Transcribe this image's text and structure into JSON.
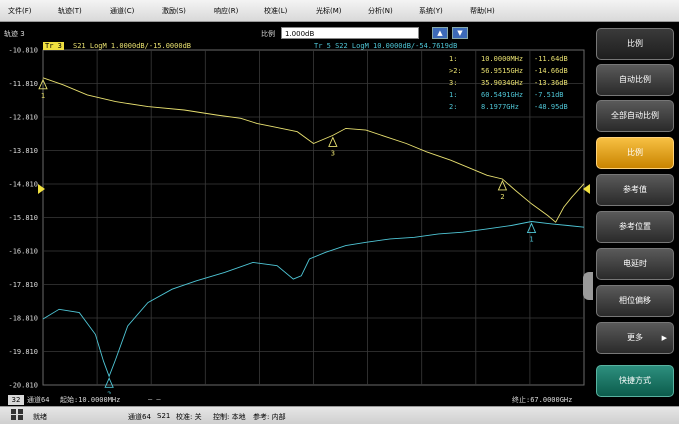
{
  "menu": [
    "文件(F)",
    "轨迹(T)",
    "通道(C)",
    "激励(S)",
    "响应(R)",
    "校准(L)",
    "光标(M)",
    "分析(N)",
    "系统(Y)",
    "帮助(H)"
  ],
  "trace_title": "轨迹 3",
  "scale": {
    "label": "比例",
    "value": "1.000dB"
  },
  "trace_headers": {
    "tr3_tag": "Tr 3",
    "tr3_text": "S21 LogM 1.0000dB/-15.0000dB",
    "tr5_text": "Tr 5  S22 LogM 10.0000dB/-54.7619dB"
  },
  "markers": [
    {
      "prefix": "1:",
      "freq": "10.0000MHz",
      "value": "-11.64dB",
      "color": "#e8e070"
    },
    {
      "prefix": ">2:",
      "freq": "56.9515GHz",
      "value": "-14.66dB",
      "color": "#e8e070"
    },
    {
      "prefix": "3:",
      "freq": "35.9034GHz",
      "value": "-13.36dB",
      "color": "#e8e070"
    },
    {
      "prefix": "1:",
      "freq": "60.5491GHz",
      "value": "-7.51dB",
      "color": "#4fc6d6"
    },
    {
      "prefix": "2:",
      "freq": "8.1977GHz",
      "value": "-48.95dB",
      "color": "#4fc6d6"
    }
  ],
  "side_buttons": [
    {
      "label": "比例",
      "style": "title"
    },
    {
      "label": "自动比例",
      "style": "normal"
    },
    {
      "label": "全部自动比例",
      "style": "normal"
    },
    {
      "label": "比例",
      "style": "active"
    },
    {
      "label": "参考值",
      "style": "normal"
    },
    {
      "label": "参考位置",
      "style": "normal"
    },
    {
      "label": "电延时",
      "style": "normal"
    },
    {
      "label": "相位偏移",
      "style": "normal"
    },
    {
      "label": "更多",
      "style": "normal",
      "arrow": "▶"
    },
    {
      "label": "快捷方式",
      "style": "teal"
    }
  ],
  "channel": {
    "num": "32",
    "name": "通道64",
    "start": "起始:10.0000MHz",
    "dash": "— —",
    "stop": "终止:67.0000GHz"
  },
  "status": {
    "ready": "就绪",
    "channel": "通道64",
    "param": "S21",
    "cal": "校准: 关",
    "ctrl": "控制: 本地",
    "ref": "参考: 内部"
  },
  "colors": {
    "trace_s21": "#e8e070",
    "trace_s22": "#4fc6d6",
    "grid": "#3a3a3a",
    "active": "#f0b030"
  },
  "chart_data": {
    "type": "line",
    "y_ticks": [
      "-10.810",
      "-11.810",
      "-12.810",
      "-13.810",
      "-14.810",
      "-15.810",
      "-16.810",
      "-17.810",
      "-18.810",
      "-19.810",
      "-20.810"
    ],
    "ylim": [
      -20.81,
      -10.81
    ],
    "xlim": [
      0.01,
      67.0
    ],
    "x_unit": "GHz",
    "series": [
      {
        "name": "S21",
        "x": [
          0.01,
          2.5,
          5.5,
          9.0,
          13.0,
          17.5,
          21.5,
          24.5,
          26.5,
          28.5,
          31.5,
          33.5,
          35.9,
          37.5,
          40.0,
          42.5,
          45.0,
          47.5,
          50.5,
          53.0,
          55.0,
          56.9,
          58.5,
          60.5,
          62.5,
          63.5,
          64.5,
          65.5,
          67.0
        ],
        "y": [
          -11.64,
          -11.85,
          -12.15,
          -12.35,
          -12.5,
          -12.6,
          -12.75,
          -12.85,
          -13.0,
          -13.1,
          -13.25,
          -13.6,
          -13.36,
          -13.15,
          -13.2,
          -13.4,
          -13.6,
          -13.85,
          -14.1,
          -14.35,
          -14.55,
          -14.66,
          -15.0,
          -15.4,
          -15.75,
          -15.95,
          -15.5,
          -15.2,
          -14.8
        ]
      },
      {
        "name": "S22",
        "x": [
          0.01,
          2.0,
          4.5,
          6.5,
          7.5,
          8.2,
          9.0,
          10.5,
          13.0,
          16.0,
          19.0,
          22.5,
          26.0,
          29.0,
          31.0,
          32.0,
          33.0,
          35.0,
          37.5,
          40.0,
          43.0,
          46.0,
          49.0,
          52.0,
          55.0,
          58.0,
          60.5,
          63.0,
          65.0,
          67.0
        ],
        "y": [
          -18.84,
          -18.55,
          -18.65,
          -19.3,
          -20.1,
          -20.55,
          -20.05,
          -19.05,
          -18.35,
          -17.95,
          -17.7,
          -17.45,
          -17.15,
          -17.25,
          -17.65,
          -17.55,
          -17.05,
          -16.85,
          -16.65,
          -16.55,
          -16.45,
          -16.4,
          -16.3,
          -16.25,
          -16.15,
          -16.05,
          -15.93,
          -16.0,
          -16.05,
          -16.1
        ]
      }
    ],
    "marker_points": [
      {
        "series": "S21",
        "label": "1",
        "x": 0.01,
        "y": -11.64
      },
      {
        "series": "S21",
        "label": "2",
        "x": 56.9,
        "y": -14.66
      },
      {
        "series": "S21",
        "label": "3",
        "x": 35.9,
        "y": -13.36
      },
      {
        "series": "S22",
        "label": "1",
        "x": 60.5,
        "y": -15.93
      },
      {
        "series": "S22",
        "label": "2",
        "x": 8.2,
        "y": -20.55
      }
    ]
  }
}
